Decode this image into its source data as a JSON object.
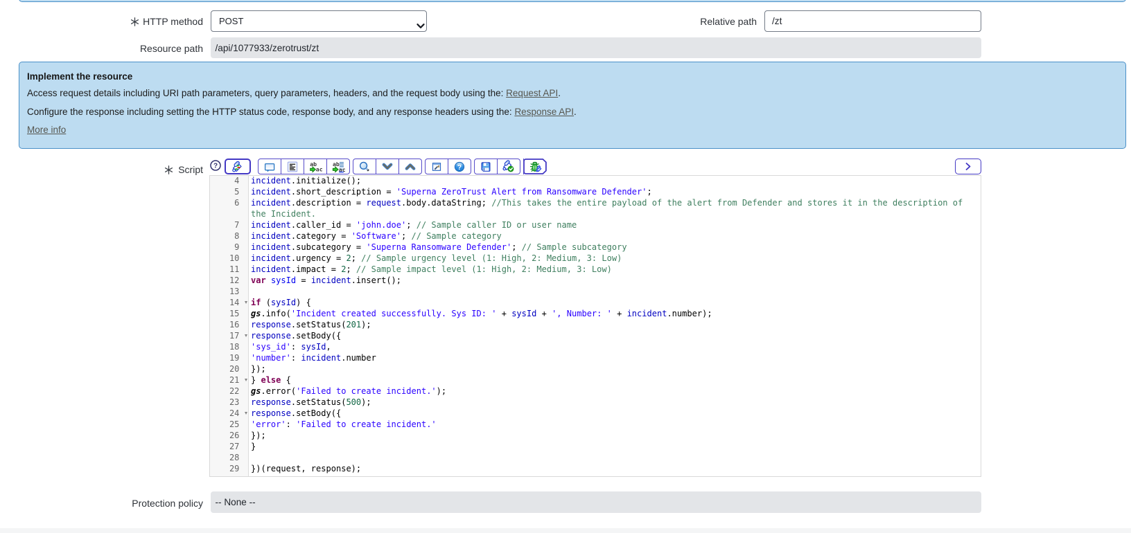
{
  "form": {
    "http_method": {
      "label": "HTTP method",
      "value": "POST",
      "mandatory": true
    },
    "relative_path": {
      "label": "Relative path",
      "value": "/zt"
    },
    "resource_path": {
      "label": "Resource path",
      "value": "/api/1077933/zerotrust/zt"
    },
    "protection_policy": {
      "label": "Protection policy",
      "value": "-- None --"
    },
    "script": {
      "label": "Script",
      "mandatory": true
    }
  },
  "info_box": {
    "title": "Implement the resource",
    "line1_text": "Access request details including URI path parameters, query parameters, headers, and the request body using the: ",
    "line1_link": "Request API",
    "line1_suffix": ".",
    "line2_text": "Configure the response including setting the HTTP status code, response body, and any response headers using the: ",
    "line2_link": "Response API",
    "line2_suffix": ".",
    "more_info": "More info"
  },
  "toolbar": {
    "help_icon": "help-circle-outline",
    "groups": [
      {
        "strong": true,
        "icons": [
          "syntax-editor-toggle"
        ]
      },
      {
        "strong": false,
        "icons": [
          "toggle-comment",
          "format-code",
          "replace",
          "replace-all"
        ]
      },
      {
        "strong": false,
        "icons": [
          "search",
          "find-next",
          "find-previous"
        ]
      },
      {
        "strong": false,
        "icons": [
          "open-in-new-window",
          "editor-help"
        ]
      },
      {
        "strong": false,
        "icons": [
          "save",
          "syntax-check"
        ]
      },
      {
        "strong": true,
        "icons": [
          "debug"
        ]
      }
    ],
    "expand_icon": "chevron-right"
  },
  "colors": {
    "annotation_bg": "#bddcf1",
    "annotation_border": "#4a90c8",
    "readonly_bg": "#e3e5e8",
    "toolbar_border": "#554bc9",
    "code_keyword": "#7f0055",
    "code_string": "#2a00ff",
    "code_comment": "#3f7f5f",
    "code_number": "#116644",
    "code_variable": "#0000c0",
    "code_def": "#0000f0"
  },
  "code": {
    "lines": [
      {
        "n": 4,
        "tokens": [
          [
            "v2",
            "incident"
          ],
          [
            "plain",
            ".initialize();"
          ]
        ]
      },
      {
        "n": 5,
        "tokens": [
          [
            "v2",
            "incident"
          ],
          [
            "plain",
            ".short_description = "
          ],
          [
            "str",
            "'Superna ZeroTrust Alert from Ransomware Defender'"
          ],
          [
            "plain",
            ";"
          ]
        ]
      },
      {
        "n": 6,
        "tokens": [
          [
            "v2",
            "incident"
          ],
          [
            "plain",
            ".description = "
          ],
          [
            "v2",
            "request"
          ],
          [
            "plain",
            ".body.dataString; "
          ],
          [
            "com",
            "//This takes the entire payload of the alert from Defender and stores it in the description of\nthe Incident."
          ]
        ]
      },
      {
        "n": 7,
        "tokens": [
          [
            "v2",
            "incident"
          ],
          [
            "plain",
            ".caller_id = "
          ],
          [
            "str",
            "'john.doe'"
          ],
          [
            "plain",
            "; "
          ],
          [
            "com",
            "// Sample caller ID or user name"
          ]
        ]
      },
      {
        "n": 8,
        "tokens": [
          [
            "v2",
            "incident"
          ],
          [
            "plain",
            ".category = "
          ],
          [
            "str",
            "'Software'"
          ],
          [
            "plain",
            "; "
          ],
          [
            "com",
            "// Sample category"
          ]
        ]
      },
      {
        "n": 9,
        "tokens": [
          [
            "v2",
            "incident"
          ],
          [
            "plain",
            ".subcategory = "
          ],
          [
            "str",
            "'Superna Ransomware Defender'"
          ],
          [
            "plain",
            "; "
          ],
          [
            "com",
            "// Sample subcategory"
          ]
        ]
      },
      {
        "n": 10,
        "tokens": [
          [
            "v2",
            "incident"
          ],
          [
            "plain",
            ".urgency = "
          ],
          [
            "num",
            "2"
          ],
          [
            "plain",
            "; "
          ],
          [
            "com",
            "// Sample urgency level (1: High, 2: Medium, 3: Low)"
          ]
        ]
      },
      {
        "n": 11,
        "tokens": [
          [
            "v2",
            "incident"
          ],
          [
            "plain",
            ".impact = "
          ],
          [
            "num",
            "2"
          ],
          [
            "plain",
            "; "
          ],
          [
            "com",
            "// Sample impact level (1: High, 2: Medium, 3: Low)"
          ]
        ]
      },
      {
        "n": 12,
        "tokens": [
          [
            "kw",
            "var"
          ],
          [
            "plain",
            " "
          ],
          [
            "def",
            "sysId"
          ],
          [
            "plain",
            " = "
          ],
          [
            "v2",
            "incident"
          ],
          [
            "plain",
            ".insert();"
          ]
        ]
      },
      {
        "n": 13,
        "tokens": []
      },
      {
        "n": 14,
        "fold": true,
        "tokens": [
          [
            "kw",
            "if"
          ],
          [
            "plain",
            " ("
          ],
          [
            "v2",
            "sysId"
          ],
          [
            "plain",
            ") {"
          ]
        ]
      },
      {
        "n": 15,
        "tokens": [
          [
            "gsv",
            "gs"
          ],
          [
            "plain",
            ".info("
          ],
          [
            "str",
            "'Incident created successfully. Sys ID: '"
          ],
          [
            "plain",
            " + "
          ],
          [
            "v2",
            "sysId"
          ],
          [
            "plain",
            " + "
          ],
          [
            "str",
            "', Number: '"
          ],
          [
            "plain",
            " + "
          ],
          [
            "v2",
            "incident"
          ],
          [
            "plain",
            ".number);"
          ]
        ]
      },
      {
        "n": 16,
        "tokens": [
          [
            "v2",
            "response"
          ],
          [
            "plain",
            ".setStatus("
          ],
          [
            "num",
            "201"
          ],
          [
            "plain",
            ");"
          ]
        ]
      },
      {
        "n": 17,
        "fold": true,
        "tokens": [
          [
            "v2",
            "response"
          ],
          [
            "plain",
            ".setBody({"
          ]
        ]
      },
      {
        "n": 18,
        "tokens": [
          [
            "str",
            "'sys_id'"
          ],
          [
            "plain",
            ": "
          ],
          [
            "v2",
            "sysId"
          ],
          [
            "plain",
            ","
          ]
        ]
      },
      {
        "n": 19,
        "tokens": [
          [
            "str",
            "'number'"
          ],
          [
            "plain",
            ": "
          ],
          [
            "v2",
            "incident"
          ],
          [
            "plain",
            ".number"
          ]
        ]
      },
      {
        "n": 20,
        "tokens": [
          [
            "plain",
            "});"
          ]
        ]
      },
      {
        "n": 21,
        "fold": true,
        "tokens": [
          [
            "plain",
            "} "
          ],
          [
            "kw",
            "else"
          ],
          [
            "plain",
            " {"
          ]
        ]
      },
      {
        "n": 22,
        "tokens": [
          [
            "gsv",
            "gs"
          ],
          [
            "plain",
            ".error("
          ],
          [
            "str",
            "'Failed to create incident.'"
          ],
          [
            "plain",
            ");"
          ]
        ]
      },
      {
        "n": 23,
        "tokens": [
          [
            "v2",
            "response"
          ],
          [
            "plain",
            ".setStatus("
          ],
          [
            "num",
            "500"
          ],
          [
            "plain",
            ");"
          ]
        ]
      },
      {
        "n": 24,
        "fold": true,
        "tokens": [
          [
            "v2",
            "response"
          ],
          [
            "plain",
            ".setBody({"
          ]
        ]
      },
      {
        "n": 25,
        "tokens": [
          [
            "str",
            "'error'"
          ],
          [
            "plain",
            ": "
          ],
          [
            "str",
            "'Failed to create incident.'"
          ]
        ]
      },
      {
        "n": 26,
        "tokens": [
          [
            "plain",
            "});"
          ]
        ]
      },
      {
        "n": 27,
        "tokens": [
          [
            "plain",
            "}"
          ]
        ]
      },
      {
        "n": 28,
        "tokens": []
      },
      {
        "n": 29,
        "tokens": [
          [
            "plain",
            "})(request, response);"
          ]
        ]
      }
    ]
  }
}
